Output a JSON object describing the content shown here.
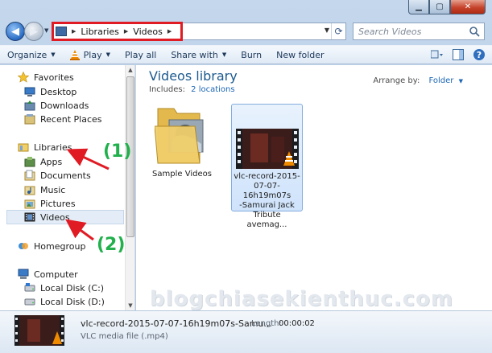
{
  "window": {
    "caption_buttons": [
      "minimize",
      "maximize",
      "close"
    ]
  },
  "address_bar": {
    "breadcrumbs": [
      "Libraries",
      "Videos"
    ],
    "search_placeholder": "Search Videos"
  },
  "toolbar": {
    "organize_label": "Organize",
    "play_label": "Play",
    "play_all_label": "Play all",
    "share_with_label": "Share with",
    "burn_label": "Burn",
    "new_folder_label": "New folder"
  },
  "nav_pane": {
    "favorites": {
      "label": "Favorites",
      "items": [
        "Desktop",
        "Downloads",
        "Recent Places"
      ]
    },
    "libraries": {
      "label": "Libraries",
      "items": [
        "Apps",
        "Documents",
        "Music",
        "Pictures",
        "Videos"
      ],
      "selected": "Videos"
    },
    "homegroup_label": "Homegroup",
    "computer": {
      "label": "Computer",
      "items": [
        "Local Disk (C:)",
        "Local Disk (D:)"
      ]
    }
  },
  "content": {
    "title": "Videos library",
    "includes_label": "Includes:",
    "locations_link": "2 locations",
    "arrange_by_label": "Arrange by:",
    "arrange_by_value": "Folder",
    "files": [
      {
        "name": "Sample Videos",
        "type": "folder"
      },
      {
        "name_lines": [
          "vlc-record-2015-",
          "07-07-16h19m07s",
          "-Samurai Jack",
          "Tribute avemag..."
        ],
        "type": "video",
        "selected": true
      }
    ]
  },
  "annotations": {
    "label_1": "(1)",
    "label_2": "(2)",
    "arrow_color": "#e01b24",
    "label_color": "#21b04c"
  },
  "watermark": "blogchiasekienthuc.com",
  "details_pane": {
    "file_name": "vlc-record-2015-07-07-16h19m07s-Samu...",
    "file_type": "VLC media file (.mp4)",
    "length_label": "Length:",
    "length_value": "00:00:02"
  },
  "colors": {
    "accent_title": "#1c5a8f",
    "link": "#1c66b6",
    "highlight_box": "#e01b24"
  }
}
